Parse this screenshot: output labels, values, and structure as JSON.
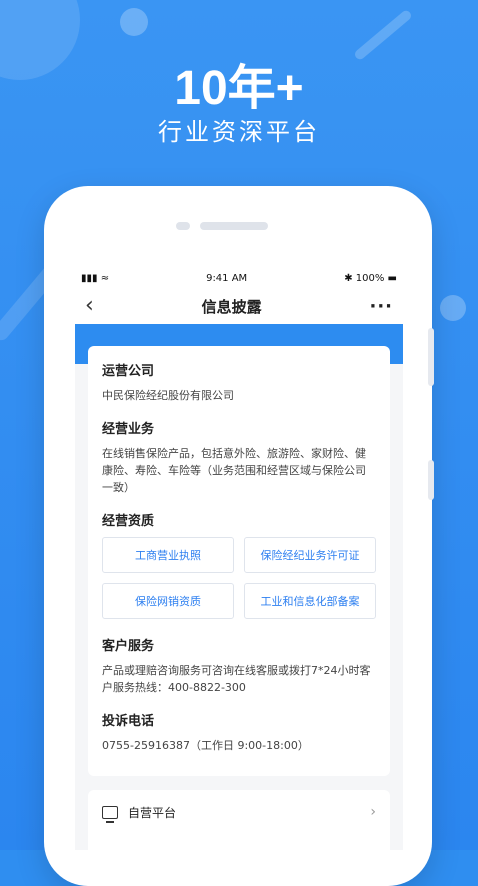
{
  "promo": {
    "headline": "10年+",
    "subline": "行业资深平台"
  },
  "status_bar": {
    "time": "9:41 AM",
    "battery": "100%"
  },
  "nav": {
    "title": "信息披露"
  },
  "sections": {
    "company": {
      "title": "运营公司",
      "text": "中民保险经纪股份有限公司"
    },
    "business": {
      "title": "经营业务",
      "text": "在线销售保险产品，包括意外险、旅游险、家财险、健康险、寿险、车险等（业务范围和经营区域与保险公司一致）"
    },
    "qualifications": {
      "title": "经营资质",
      "buttons": [
        "工商营业执照",
        "保险经纪业务许可证",
        "保险网销资质",
        "工业和信息化部备案"
      ]
    },
    "service": {
      "title": "客户服务",
      "text": "产品或理赔咨询服务可咨询在线客服或拨打7*24小时客户服务热线：400-8822-300"
    },
    "complaint": {
      "title": "投诉电话",
      "text": "0755-25916387（工作日 9:00-18:00）"
    }
  },
  "list": {
    "self_platform": "自营平台"
  },
  "colors": {
    "brand_blue": "#2d8cf0"
  }
}
